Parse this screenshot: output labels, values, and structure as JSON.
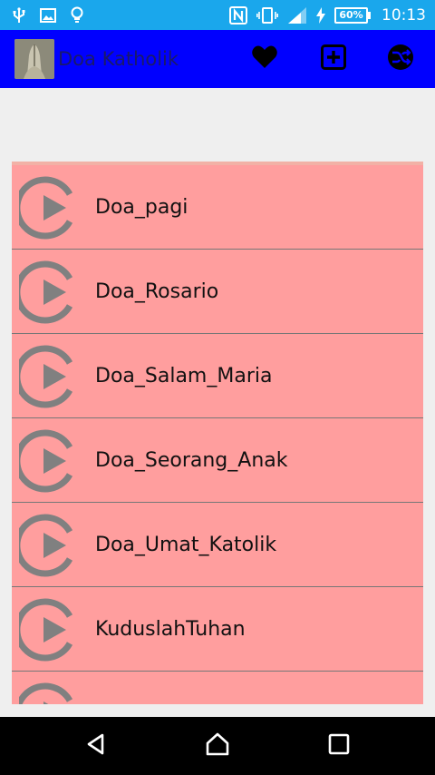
{
  "status_bar": {
    "time": "10:13",
    "battery": "60%",
    "icons": [
      "usb-icon",
      "image-icon",
      "lightbulb-icon",
      "nfc-icon",
      "vibrate-icon",
      "signal-icon",
      "charging-icon"
    ]
  },
  "app_bar": {
    "title": "Doa Katholik",
    "actions": [
      "favorite-heart-icon",
      "add-box-icon",
      "shuffle-icon"
    ]
  },
  "list": {
    "items": [
      {
        "label": "Doa_pagi"
      },
      {
        "label": "Doa_Rosario"
      },
      {
        "label": "Doa_Salam_Maria"
      },
      {
        "label": "Doa_Seorang_Anak"
      },
      {
        "label": "Doa_Umat_Katolik"
      },
      {
        "label": "KuduslahTuhan"
      },
      {
        "label": ""
      }
    ]
  },
  "nav_bar": {
    "buttons": [
      "back-icon",
      "home-icon",
      "recents-icon"
    ]
  },
  "colors": {
    "status_bar": "#1aa7ec",
    "app_bar": "#0000ff",
    "list_bg": "#ff9e9e",
    "play_icon": "#808080"
  }
}
